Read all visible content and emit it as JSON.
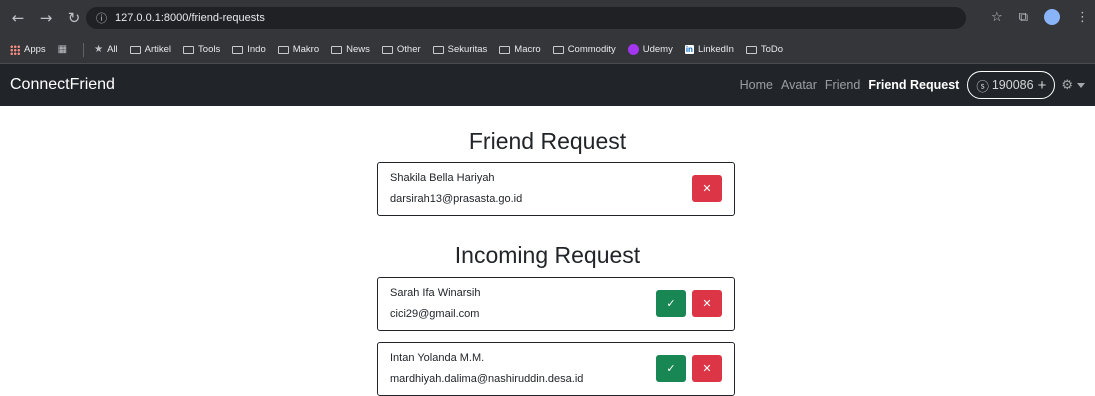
{
  "browser": {
    "url": "127.0.0.1:8000/friend-requests",
    "bookmarks": [
      {
        "label": "Apps",
        "icon": "apps-grid-icon"
      },
      {
        "label": "All",
        "icon": "star-icon"
      },
      {
        "label": "Artikel",
        "icon": "folder-icon"
      },
      {
        "label": "Tools",
        "icon": "folder-icon"
      },
      {
        "label": "Indo",
        "icon": "folder-icon"
      },
      {
        "label": "Makro",
        "icon": "folder-icon"
      },
      {
        "label": "News",
        "icon": "folder-icon"
      },
      {
        "label": "Other",
        "icon": "folder-icon"
      },
      {
        "label": "Sekuritas",
        "icon": "folder-icon"
      },
      {
        "label": "Macro",
        "icon": "folder-icon"
      },
      {
        "label": "Commodity",
        "icon": "folder-icon"
      },
      {
        "label": "Udemy",
        "icon": "udemy-icon"
      },
      {
        "label": "LinkedIn",
        "icon": "linkedin-icon"
      },
      {
        "label": "ToDo",
        "icon": "folder-icon"
      }
    ]
  },
  "navbar": {
    "brand": "ConnectFriend",
    "links": {
      "home": "Home",
      "avatar": "Avatar",
      "friend": "Friend",
      "friend_request": "Friend Request"
    },
    "coins": "190086",
    "coin_plus": "+"
  },
  "friend_request": {
    "title": "Friend Request",
    "items": [
      {
        "name": "Shakila Bella Hariyah",
        "email": "darsirah13@prasasta.go.id"
      }
    ]
  },
  "incoming_request": {
    "title": "Incoming Request",
    "items": [
      {
        "name": "Sarah Ifa Winarsih",
        "email": "cici29@gmail.com"
      },
      {
        "name": "Intan Yolanda M.M.",
        "email": "mardhiyah.dalima@nashiruddin.desa.id"
      }
    ]
  },
  "colors": {
    "navbar_bg": "#212529",
    "danger": "#dc3545",
    "success": "#198754"
  }
}
